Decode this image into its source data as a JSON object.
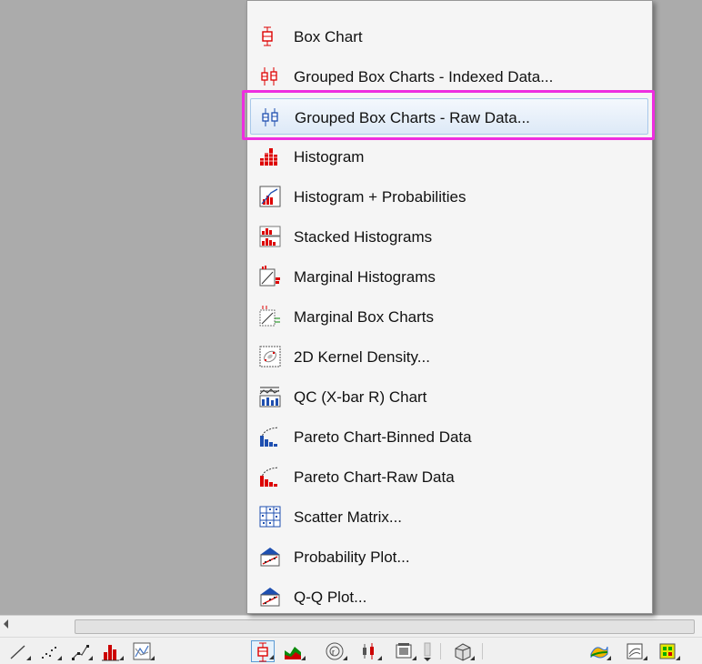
{
  "menu": {
    "items": [
      {
        "label": "Box Chart",
        "icon": "box-chart-icon"
      },
      {
        "label": "Grouped Box Charts - Indexed Data...",
        "icon": "grouped-box-indexed-icon"
      },
      {
        "label": "Grouped Box Charts - Raw Data...",
        "icon": "grouped-box-raw-icon",
        "highlighted": true
      },
      {
        "label": "Histogram",
        "icon": "histogram-icon"
      },
      {
        "label": "Histogram + Probabilities",
        "icon": "histogram-probabilities-icon"
      },
      {
        "label": "Stacked Histograms",
        "icon": "stacked-histograms-icon"
      },
      {
        "label": "Marginal Histograms",
        "icon": "marginal-histograms-icon"
      },
      {
        "label": "Marginal Box Charts",
        "icon": "marginal-box-charts-icon"
      },
      {
        "label": "2D Kernel Density...",
        "icon": "kernel-density-icon"
      },
      {
        "label": "QC (X-bar R) Chart",
        "icon": "qc-chart-icon"
      },
      {
        "label": "Pareto Chart-Binned Data",
        "icon": "pareto-binned-icon"
      },
      {
        "label": "Pareto Chart-Raw Data",
        "icon": "pareto-raw-icon"
      },
      {
        "label": "Scatter Matrix...",
        "icon": "scatter-matrix-icon"
      },
      {
        "label": "Probability Plot...",
        "icon": "probability-plot-icon"
      },
      {
        "label": "Q-Q Plot...",
        "icon": "qq-plot-icon"
      }
    ]
  },
  "toolbar": {
    "buttons": [
      {
        "icon": "line-icon"
      },
      {
        "icon": "scatter-icon"
      },
      {
        "icon": "line-symbol-icon"
      },
      {
        "icon": "column-icon"
      },
      {
        "icon": "multi-panel-icon"
      },
      {
        "icon": "box-chart-icon",
        "active": true
      },
      {
        "icon": "area-icon"
      },
      {
        "icon": "polar-icon"
      },
      {
        "icon": "stock-icon"
      },
      {
        "icon": "template-icon"
      },
      {
        "icon": "3d-icon"
      },
      {
        "icon": "3d-surface-icon"
      },
      {
        "icon": "contour-icon"
      },
      {
        "icon": "matrix-image-icon"
      }
    ]
  },
  "colors": {
    "highlight_callout": "#ee2ee0",
    "menu_bg": "#f5f5f5",
    "workspace_bg": "#ababab"
  }
}
